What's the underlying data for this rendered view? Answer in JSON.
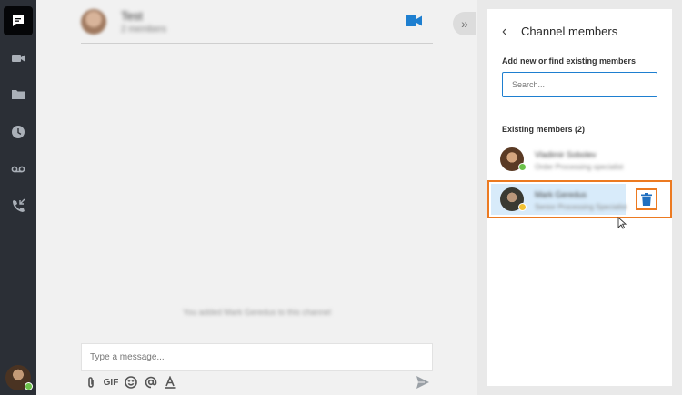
{
  "rail": {
    "items": [
      {
        "name": "messages-icon",
        "active": true
      },
      {
        "name": "video-icon",
        "active": false
      },
      {
        "name": "folder-icon",
        "active": false
      },
      {
        "name": "clock-icon",
        "active": false
      },
      {
        "name": "voicemail-icon",
        "active": false
      },
      {
        "name": "phone-incoming-icon",
        "active": false
      }
    ],
    "user_status_color": "#6cc24a"
  },
  "chat": {
    "channel_name": "Test",
    "channel_subtitle": "2 members",
    "system_message": "You added Mark Geredus to this channel",
    "composer_placeholder": "Type a message...",
    "gif_label": "GIF",
    "accent_color": "#1e7fd0"
  },
  "panel": {
    "collapse_glyph": "»",
    "back_glyph": "‹",
    "title": "Channel members",
    "add_label": "Add new or find existing members",
    "search_placeholder": "Search...",
    "existing_label": "Existing members (2)",
    "members": [
      {
        "name": "Vladimir Sobolev",
        "role": "Order Processing specialist",
        "status_color": "#6cc24a"
      },
      {
        "name": "Mark Geredus",
        "role": "Senior Processing Specialist",
        "status_color": "#f2c233"
      }
    ],
    "highlight_color": "#ec7a21"
  }
}
